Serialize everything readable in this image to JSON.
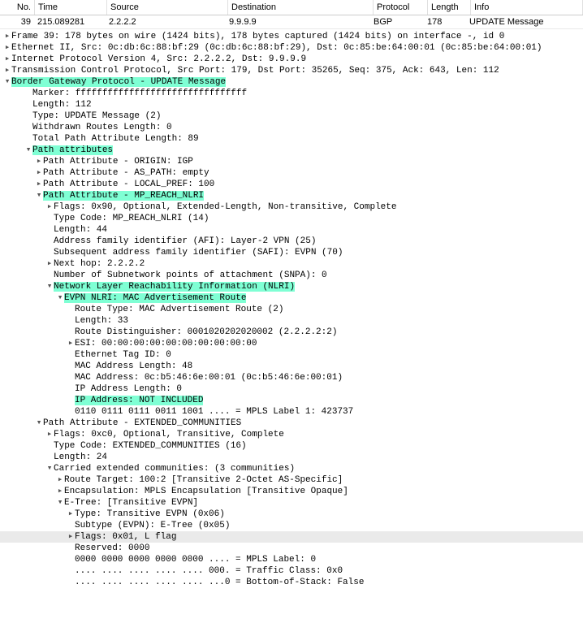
{
  "columns": {
    "no": "No.",
    "time": "Time",
    "source": "Source",
    "destination": "Destination",
    "protocol": "Protocol",
    "length": "Length",
    "info": "Info"
  },
  "packet": {
    "no": "39",
    "time": "215.089281",
    "source": "2.2.2.2",
    "destination": "9.9.9.9",
    "protocol": "BGP",
    "length": "178",
    "info": "UPDATE Message"
  },
  "tree": {
    "frame": "Frame 39: 178 bytes on wire (1424 bits), 178 bytes captured (1424 bits) on interface -, id 0",
    "eth": "Ethernet II, Src: 0c:db:6c:88:bf:29 (0c:db:6c:88:bf:29), Dst: 0c:85:be:64:00:01 (0c:85:be:64:00:01)",
    "ip": "Internet Protocol Version 4, Src: 2.2.2.2, Dst: 9.9.9.9",
    "tcp": "Transmission Control Protocol, Src Port: 179, Dst Port: 35265, Seq: 375, Ack: 643, Len: 112",
    "bgp": "Border Gateway Protocol - UPDATE Message",
    "marker": "Marker: ffffffffffffffffffffffffffffffff",
    "length_112": "Length: 112",
    "type_update": "Type: UPDATE Message (2)",
    "withdrawn": "Withdrawn Routes Length: 0",
    "total_path": "Total Path Attribute Length: 89",
    "path_attrs": "Path attributes",
    "pa_origin": "Path Attribute - ORIGIN: IGP",
    "pa_aspath": "Path Attribute - AS_PATH: empty",
    "pa_localpref": "Path Attribute - LOCAL_PREF: 100",
    "pa_mp": "Path Attribute - MP_REACH_NLRI",
    "mp_flags": "Flags: 0x90, Optional, Extended-Length, Non-transitive, Complete",
    "mp_typecode": "Type Code: MP_REACH_NLRI (14)",
    "mp_len": "Length: 44",
    "mp_afi": "Address family identifier (AFI): Layer-2 VPN (25)",
    "mp_safi": "Subsequent address family identifier (SAFI): EVPN (70)",
    "mp_nexthop": "Next hop: 2.2.2.2",
    "mp_snpa": "Number of Subnetwork points of attachment (SNPA): 0",
    "nlri": "Network Layer Reachability Information (NLRI)",
    "evpn_nlri": "EVPN NLRI: MAC Advertisement Route",
    "route_type": "Route Type: MAC Advertisement Route (2)",
    "route_len": "Length: 33",
    "route_rd": "Route Distinguisher: 0001020202020002 (2.2.2.2:2)",
    "route_esi": "ESI: 00:00:00:00:00:00:00:00:00:00",
    "route_etag": "Ethernet Tag ID: 0",
    "mac_len": "MAC Address Length: 48",
    "mac_addr": "MAC Address: 0c:b5:46:6e:00:01 (0c:b5:46:6e:00:01)",
    "ip_len": "IP Address Length: 0",
    "ip_addr": "IP Address: NOT INCLUDED",
    "mpls_label1": "0110 0111 0111 0011 1001 .... = MPLS Label 1: 423737",
    "pa_extcomm": "Path Attribute - EXTENDED_COMMUNITIES",
    "ec_flags": "Flags: 0xc0, Optional, Transitive, Complete",
    "ec_typecode": "Type Code: EXTENDED_COMMUNITIES (16)",
    "ec_len": "Length: 24",
    "ec_carried": "Carried extended communities: (3 communities)",
    "ec_rt": "Route Target: 100:2 [Transitive 2-Octet AS-Specific]",
    "ec_encap": "Encapsulation: MPLS Encapsulation [Transitive Opaque]",
    "ec_etree": "E-Tree: [Transitive EVPN]",
    "et_type": "Type: Transitive EVPN (0x06)",
    "et_subtype": "Subtype (EVPN): E-Tree (0x05)",
    "et_flags": "Flags: 0x01, L flag",
    "et_reserved": "Reserved: 0000",
    "et_mpls": "0000 0000 0000 0000 0000 .... = MPLS Label: 0",
    "et_tc": ".... .... .... .... .... 000. = Traffic Class: 0x0",
    "et_bos": ".... .... .... .... .... ...0 = Bottom-of-Stack: False"
  }
}
